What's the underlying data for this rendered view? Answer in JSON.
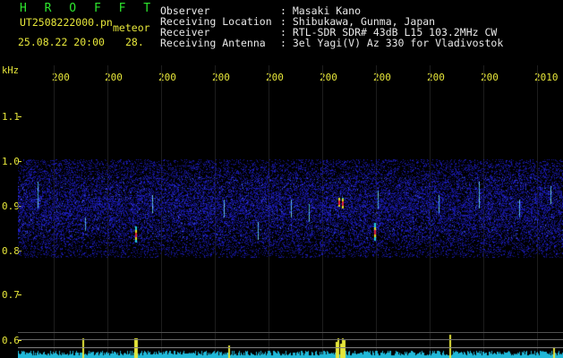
{
  "header": {
    "logo": "H R O F F T",
    "filename": "UT2508222000.pn",
    "meteor_label": "meteor",
    "datetime": "25.08.22 20:00",
    "extra_number": "28."
  },
  "info": {
    "observer_label": "Observer",
    "observer_value": ": Masaki Kano",
    "location_label": "Receiving Location",
    "location_value": ": Shibukawa, Gunma, Japan",
    "receiver_label": "Receiver",
    "receiver_value": ": RTL-SDR SDR# 43dB L15 103.2MHz CW",
    "antenna_label": "Receiving Antenna",
    "antenna_value": ": 3el Yagi(V) Az 330 for Vladivostok"
  },
  "axes": {
    "y_unit": "kHz",
    "y_ticks": [
      "1.1",
      "1.0",
      "0.9",
      "0.8",
      "0.7",
      "0.6"
    ],
    "x_ticks": [
      "200",
      "200",
      "200",
      "200",
      "200",
      "200",
      "200",
      "200",
      "200",
      "2010"
    ]
  },
  "colors": {
    "text_white": "#e8e8e8",
    "text_yellow": "#e6e63a",
    "logo_green": "#2ee62e",
    "noise_blue": "#1a1aa0",
    "meteor_red": "#e0203c",
    "meteor_cyan": "#24d0e0",
    "spectrum_cyan": "#20b8d8"
  }
}
